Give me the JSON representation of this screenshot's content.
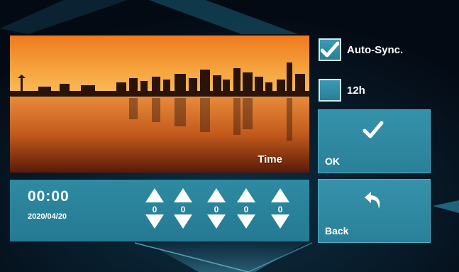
{
  "photo": {
    "label": "Time",
    "icon": "city-skyline-sunset-image"
  },
  "options": [
    {
      "label": "Auto-Sync.",
      "checked": true
    },
    {
      "label": "12h",
      "checked": false
    }
  ],
  "clock": {
    "time": "00:00",
    "date": "2020/04/20",
    "digits": [
      "0",
      "0",
      "0",
      "0",
      "0"
    ]
  },
  "buttons": {
    "ok": {
      "label": "OK",
      "icon": "checkmark-icon"
    },
    "back": {
      "label": "Back",
      "icon": "back-arrow-icon"
    }
  },
  "colors": {
    "accent": "#2e8aa2",
    "background": "#050d18",
    "text": "#ffffff"
  }
}
